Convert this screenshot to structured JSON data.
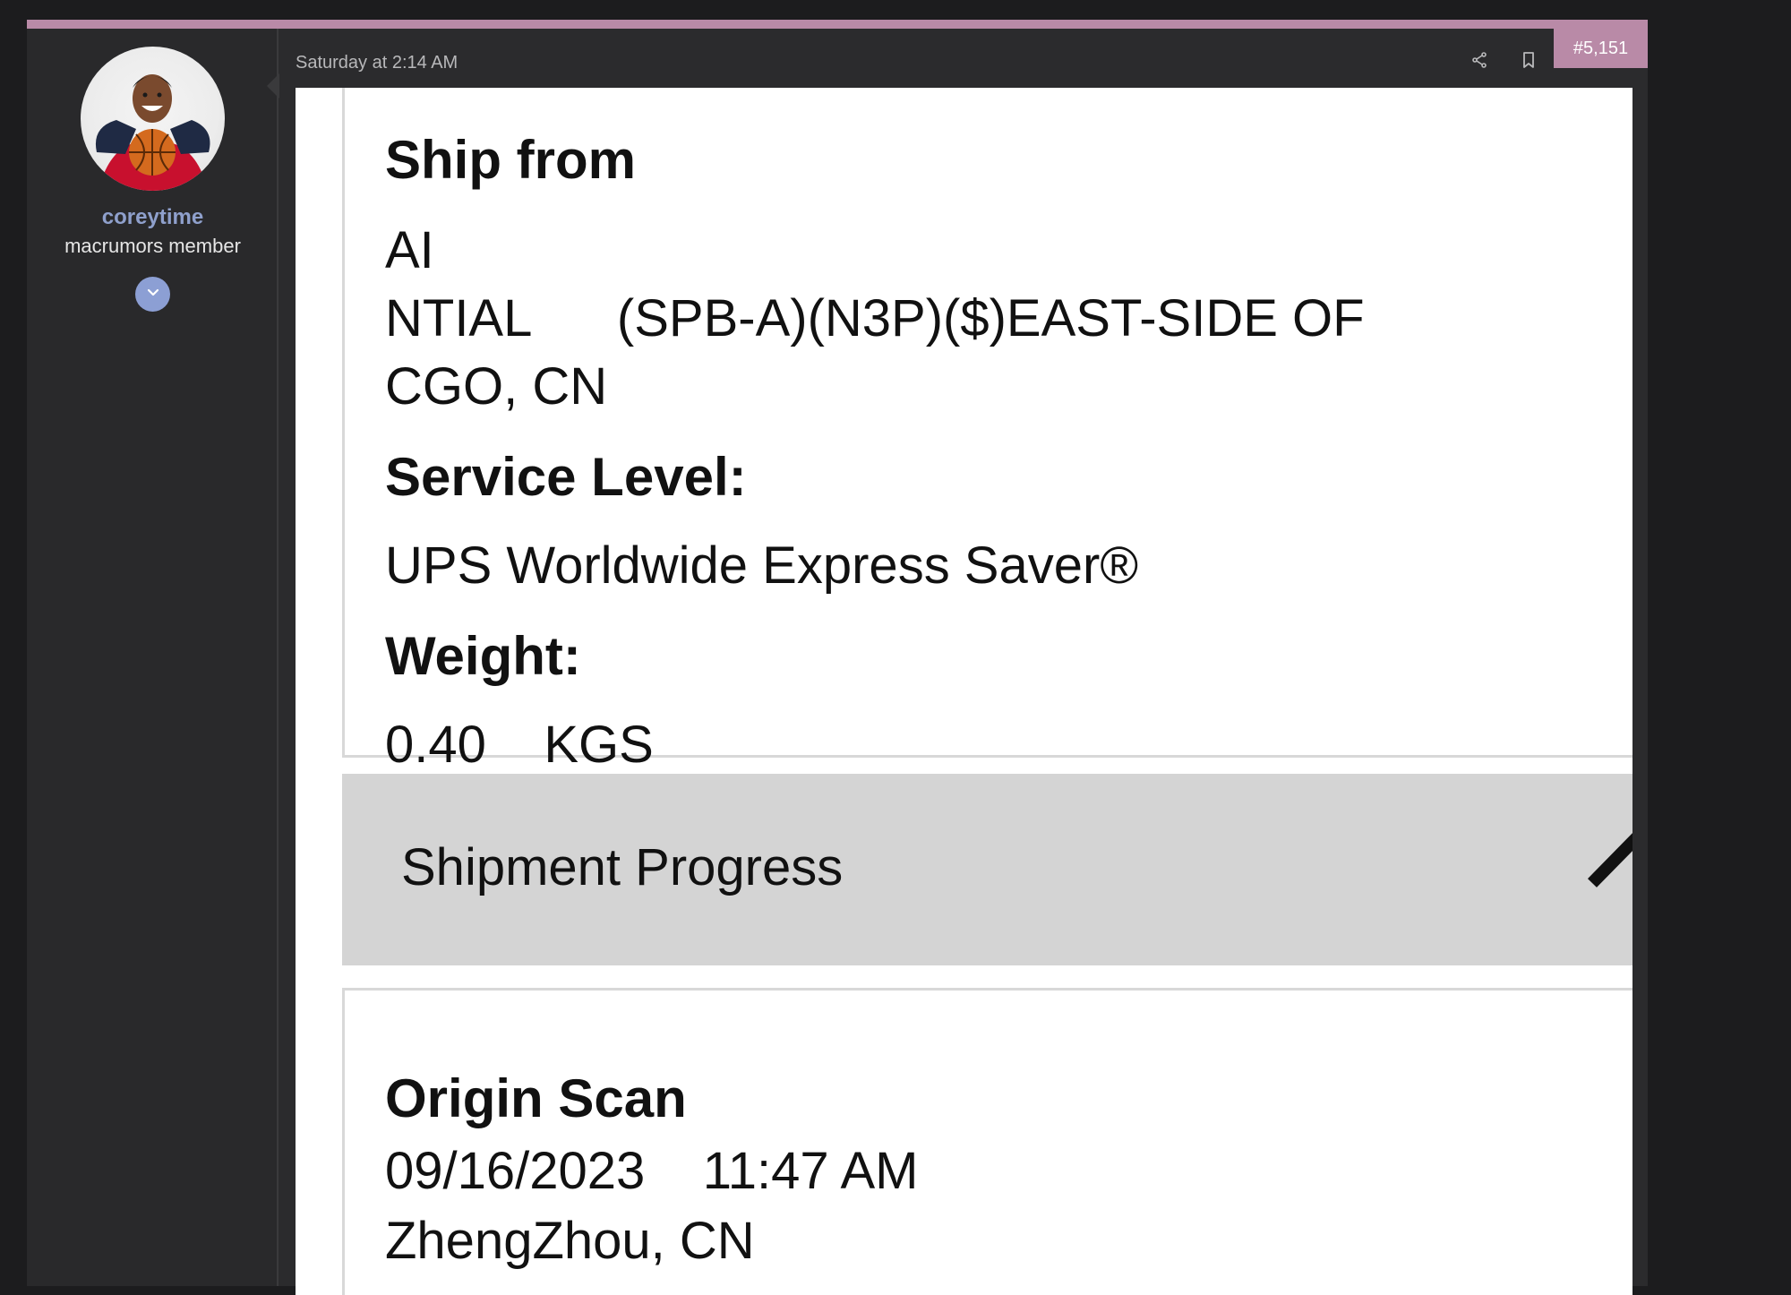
{
  "user": {
    "username": "coreytime",
    "title": "macrumors member"
  },
  "post": {
    "timestamp": "Saturday at 2:14 AM",
    "number": "#5,151"
  },
  "attachment": {
    "ship_from_heading": "Ship from",
    "ship_from_line1": "AI",
    "ship_from_line2": "NTIAL      (SPB-A)(N3P)($)EAST-SIDE OF",
    "ship_from_line3": "CGO, CN",
    "service_level_heading": "Service Level:",
    "service_level_value": "UPS Worldwide Express Saver®",
    "weight_heading": "Weight:",
    "weight_value": "0.40    KGS",
    "progress_label": "Shipment Progress",
    "origin_scan_heading": "Origin Scan",
    "origin_scan_datetime": "09/16/2023    11:47 AM",
    "origin_scan_location": "ZhengZhou, CN"
  },
  "colors": {
    "accent_pink": "#b98aa7",
    "username_blue": "#8fa0cc",
    "expand_button": "#8c9fd4"
  },
  "icons": [
    "share-icon",
    "bookmark-icon",
    "chevron-down-icon",
    "caret-up-icon"
  ]
}
